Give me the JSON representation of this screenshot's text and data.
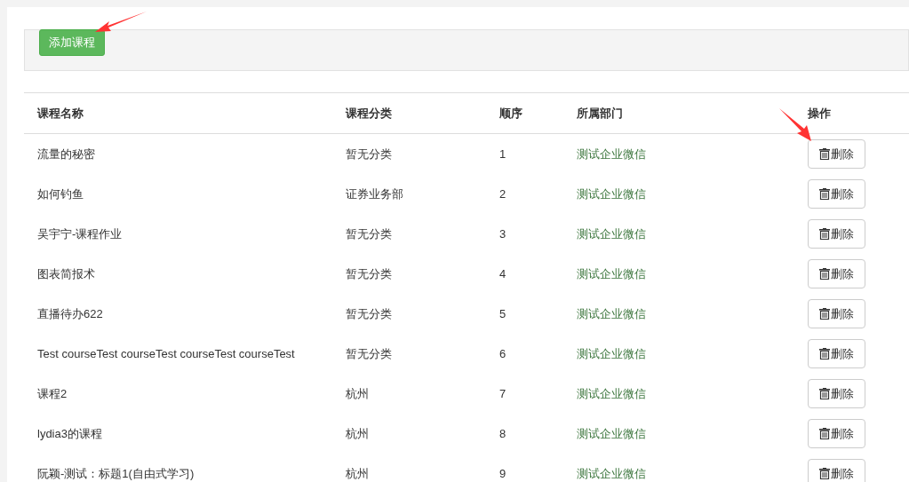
{
  "toolbar": {
    "add_button": "添加课程"
  },
  "table": {
    "columns": [
      "课程名称",
      "课程分类",
      "顺序",
      "所属部门",
      "操作"
    ],
    "rows": [
      {
        "name": "流量的秘密",
        "category": "暂无分类",
        "order": "1",
        "department": "测试企业微信",
        "action": "删除"
      },
      {
        "name": "如何钓鱼",
        "category": "证券业务部",
        "order": "2",
        "department": "测试企业微信",
        "action": "删除"
      },
      {
        "name": "吴宇宁-课程作业",
        "category": "暂无分类",
        "order": "3",
        "department": "测试企业微信",
        "action": "删除"
      },
      {
        "name": "图表简报术",
        "category": "暂无分类",
        "order": "4",
        "department": "测试企业微信",
        "action": "删除"
      },
      {
        "name": "直播待办622",
        "category": "暂无分类",
        "order": "5",
        "department": "测试企业微信",
        "action": "删除"
      },
      {
        "name": "Test courseTest courseTest courseTest courseTest",
        "category": "暂无分类",
        "order": "6",
        "department": "测试企业微信",
        "action": "删除"
      },
      {
        "name": "课程2",
        "category": "杭州",
        "order": "7",
        "department": "测试企业微信",
        "action": "删除"
      },
      {
        "name": "lydia3的课程",
        "category": "杭州",
        "order": "8",
        "department": "测试企业微信",
        "action": "删除"
      },
      {
        "name": "阮颖-测试：标题1(自由式学习)",
        "category": "杭州",
        "order": "9",
        "department": "测试企业微信",
        "action": "删除"
      }
    ]
  }
}
